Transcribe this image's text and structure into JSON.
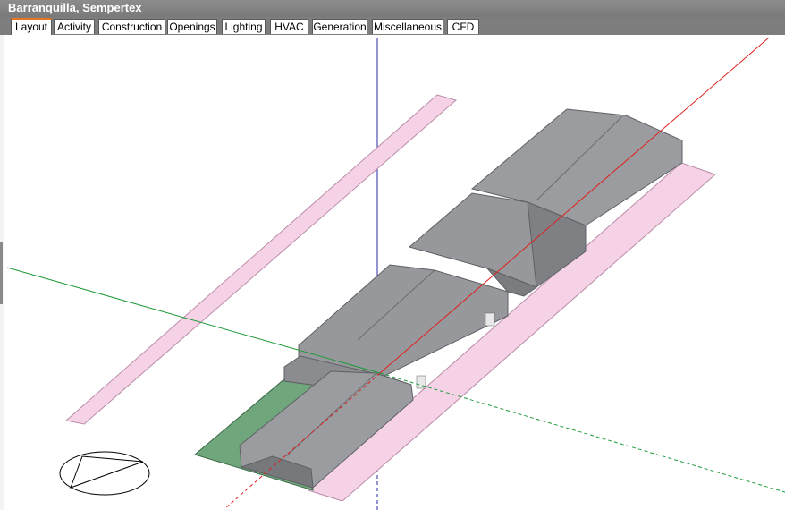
{
  "window": {
    "title": "Barranquilla, Sempertex"
  },
  "tabs": [
    {
      "label": "Layout",
      "active": true
    },
    {
      "label": "Activity",
      "active": false
    },
    {
      "label": "Construction",
      "active": false
    },
    {
      "label": "Openings",
      "active": false
    },
    {
      "label": "Lighting",
      "active": false
    },
    {
      "label": "HVAC",
      "active": false
    },
    {
      "label": "Generation",
      "active": false
    },
    {
      "label": "Miscellaneous",
      "active": false
    },
    {
      "label": "CFD",
      "active": false
    }
  ],
  "colors": {
    "accent_tab": "#e8761e",
    "axis_x": "#e0201e",
    "axis_y": "#1e9a3a",
    "axis_z": "#2a2aa0",
    "building": "#8f9194",
    "shade": "#f6d2e6",
    "ground": "#6fa67c"
  },
  "viewport": {
    "icons": [
      "compass-icon"
    ]
  }
}
